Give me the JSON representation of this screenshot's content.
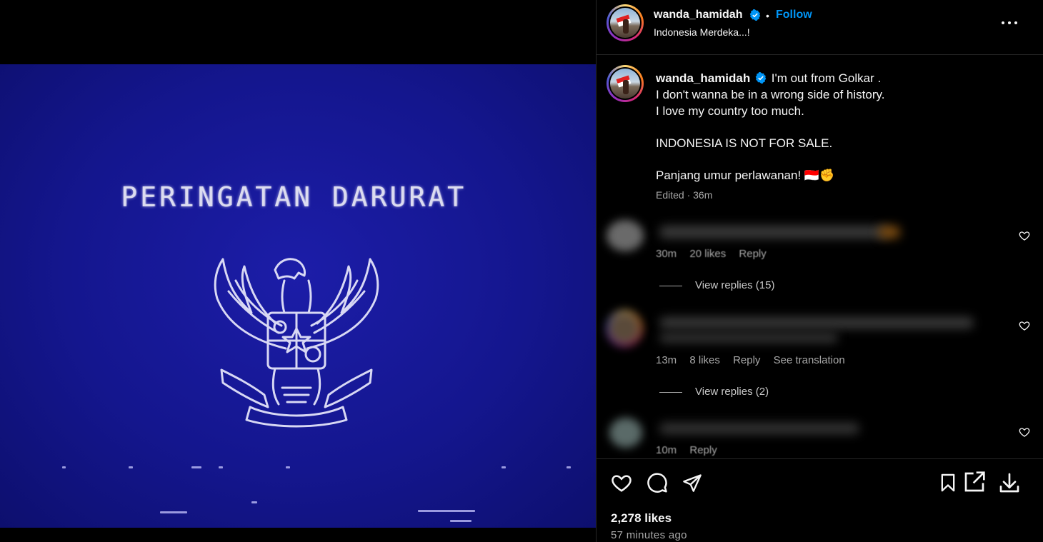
{
  "header": {
    "username": "wanda_hamidah",
    "separator": "•",
    "follow_label": "Follow",
    "location": "Indonesia Merdeka...!"
  },
  "media": {
    "title": "PERINGATAN DARURAT"
  },
  "caption": {
    "username": "wanda_hamidah",
    "lines": [
      "I'm out from Golkar .",
      "I don't wanna be in a wrong side of history.",
      "I love my country too much.",
      "INDONESIA IS NOT FOR SALE.",
      "Panjang umur perlawanan! 🇮🇩✊"
    ],
    "meta": "Edited · 36m"
  },
  "comments": [
    {
      "time": "30m",
      "likes": "20 likes",
      "reply": "Reply",
      "view_replies": "View replies (15)"
    },
    {
      "time": "13m",
      "likes": "8 likes",
      "reply": "Reply",
      "translation": "See translation",
      "view_replies": "View replies (2)"
    },
    {
      "time": "10m",
      "reply": "Reply"
    }
  ],
  "footer": {
    "likes": "2,278 likes",
    "time_ago": "57 minutes ago"
  },
  "colors": {
    "background": "#000000",
    "accent": "#0095f6",
    "media_blue": "#14168e",
    "muted_text": "#a8a8a8"
  },
  "icons": [
    "more-options-icon",
    "verified-icon",
    "heart-icon",
    "comment-icon",
    "share-icon",
    "bookmark-icon",
    "external-link-icon",
    "download-icon"
  ]
}
